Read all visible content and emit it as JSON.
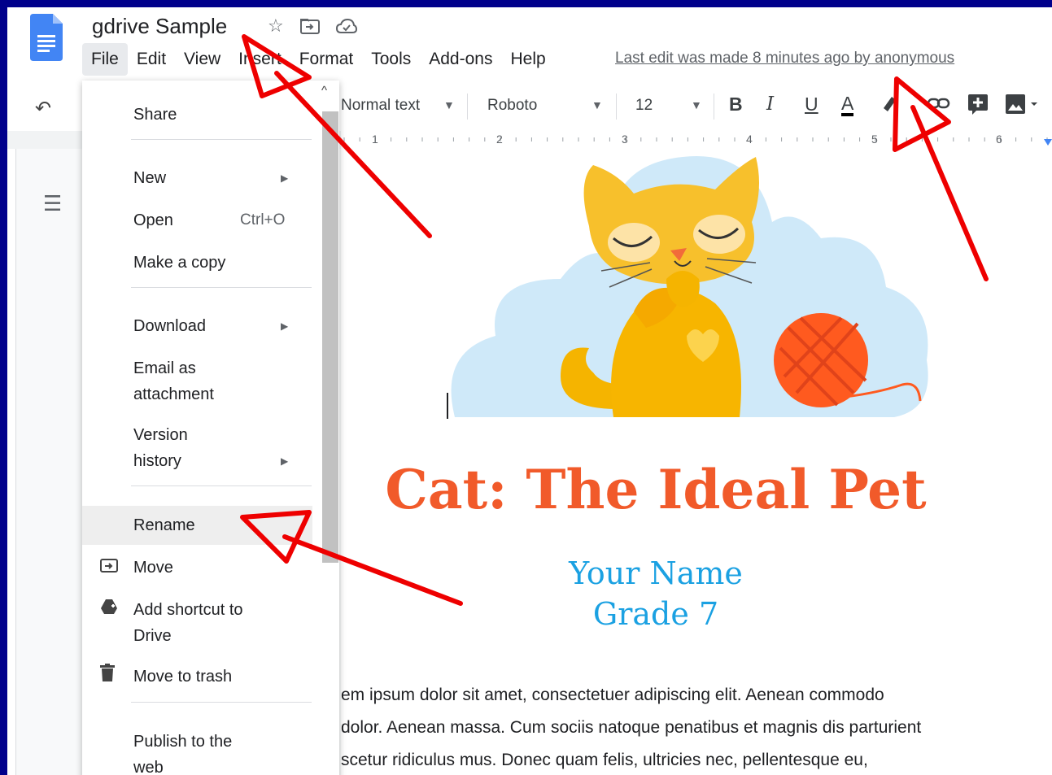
{
  "header": {
    "title": "gdrive Sample",
    "icons": [
      "star-icon",
      "move-to-folder-icon",
      "cloud-status-icon"
    ],
    "menu": [
      "File",
      "Edit",
      "View",
      "Insert",
      "Format",
      "Tools",
      "Add-ons",
      "Help"
    ],
    "last_edit": "Last edit was made 8 minutes ago by anonymous"
  },
  "toolbar": {
    "undo": "undo-icon",
    "style": "Normal text",
    "font": "Roboto",
    "size": "12",
    "bold": "B",
    "italic": "I",
    "underline": "U",
    "text_color": "A"
  },
  "ruler": {
    "numbers": [
      "1",
      "2",
      "3",
      "4",
      "5",
      "6"
    ]
  },
  "file_menu": {
    "items": [
      {
        "label": "Share"
      },
      {
        "label": "New"
      },
      {
        "label": "Open",
        "shortcut": "Ctrl+O"
      },
      {
        "label": "Make a copy"
      },
      {
        "label": "Download"
      },
      {
        "label": "Email as",
        "label2": "attachment"
      },
      {
        "label": "Version",
        "label2": "history"
      },
      {
        "label": "Rename"
      },
      {
        "label": "Move"
      },
      {
        "label": "Add shortcut to",
        "label2": "Drive"
      },
      {
        "label": "Move to trash"
      },
      {
        "label": "Publish to the",
        "label2": "web"
      }
    ],
    "hovered": "Rename"
  },
  "document": {
    "title": "Cat: The Ideal Pet",
    "name": "Your Name",
    "grade": "Grade 7",
    "body_lines": [
      "em ipsum dolor sit amet, consectetuer adipiscing elit. Aenean commodo",
      "dolor. Aenean massa. Cum sociis natoque penatibus et magnis dis parturient",
      "scetur ridiculus mus. Donec quam felis, ultricies nec, pellentesque eu,"
    ]
  },
  "colors": {
    "frame": "#00008b",
    "title": "#f15a2a",
    "subtitle": "#1ba1e2",
    "arrow": "#ee0000"
  }
}
